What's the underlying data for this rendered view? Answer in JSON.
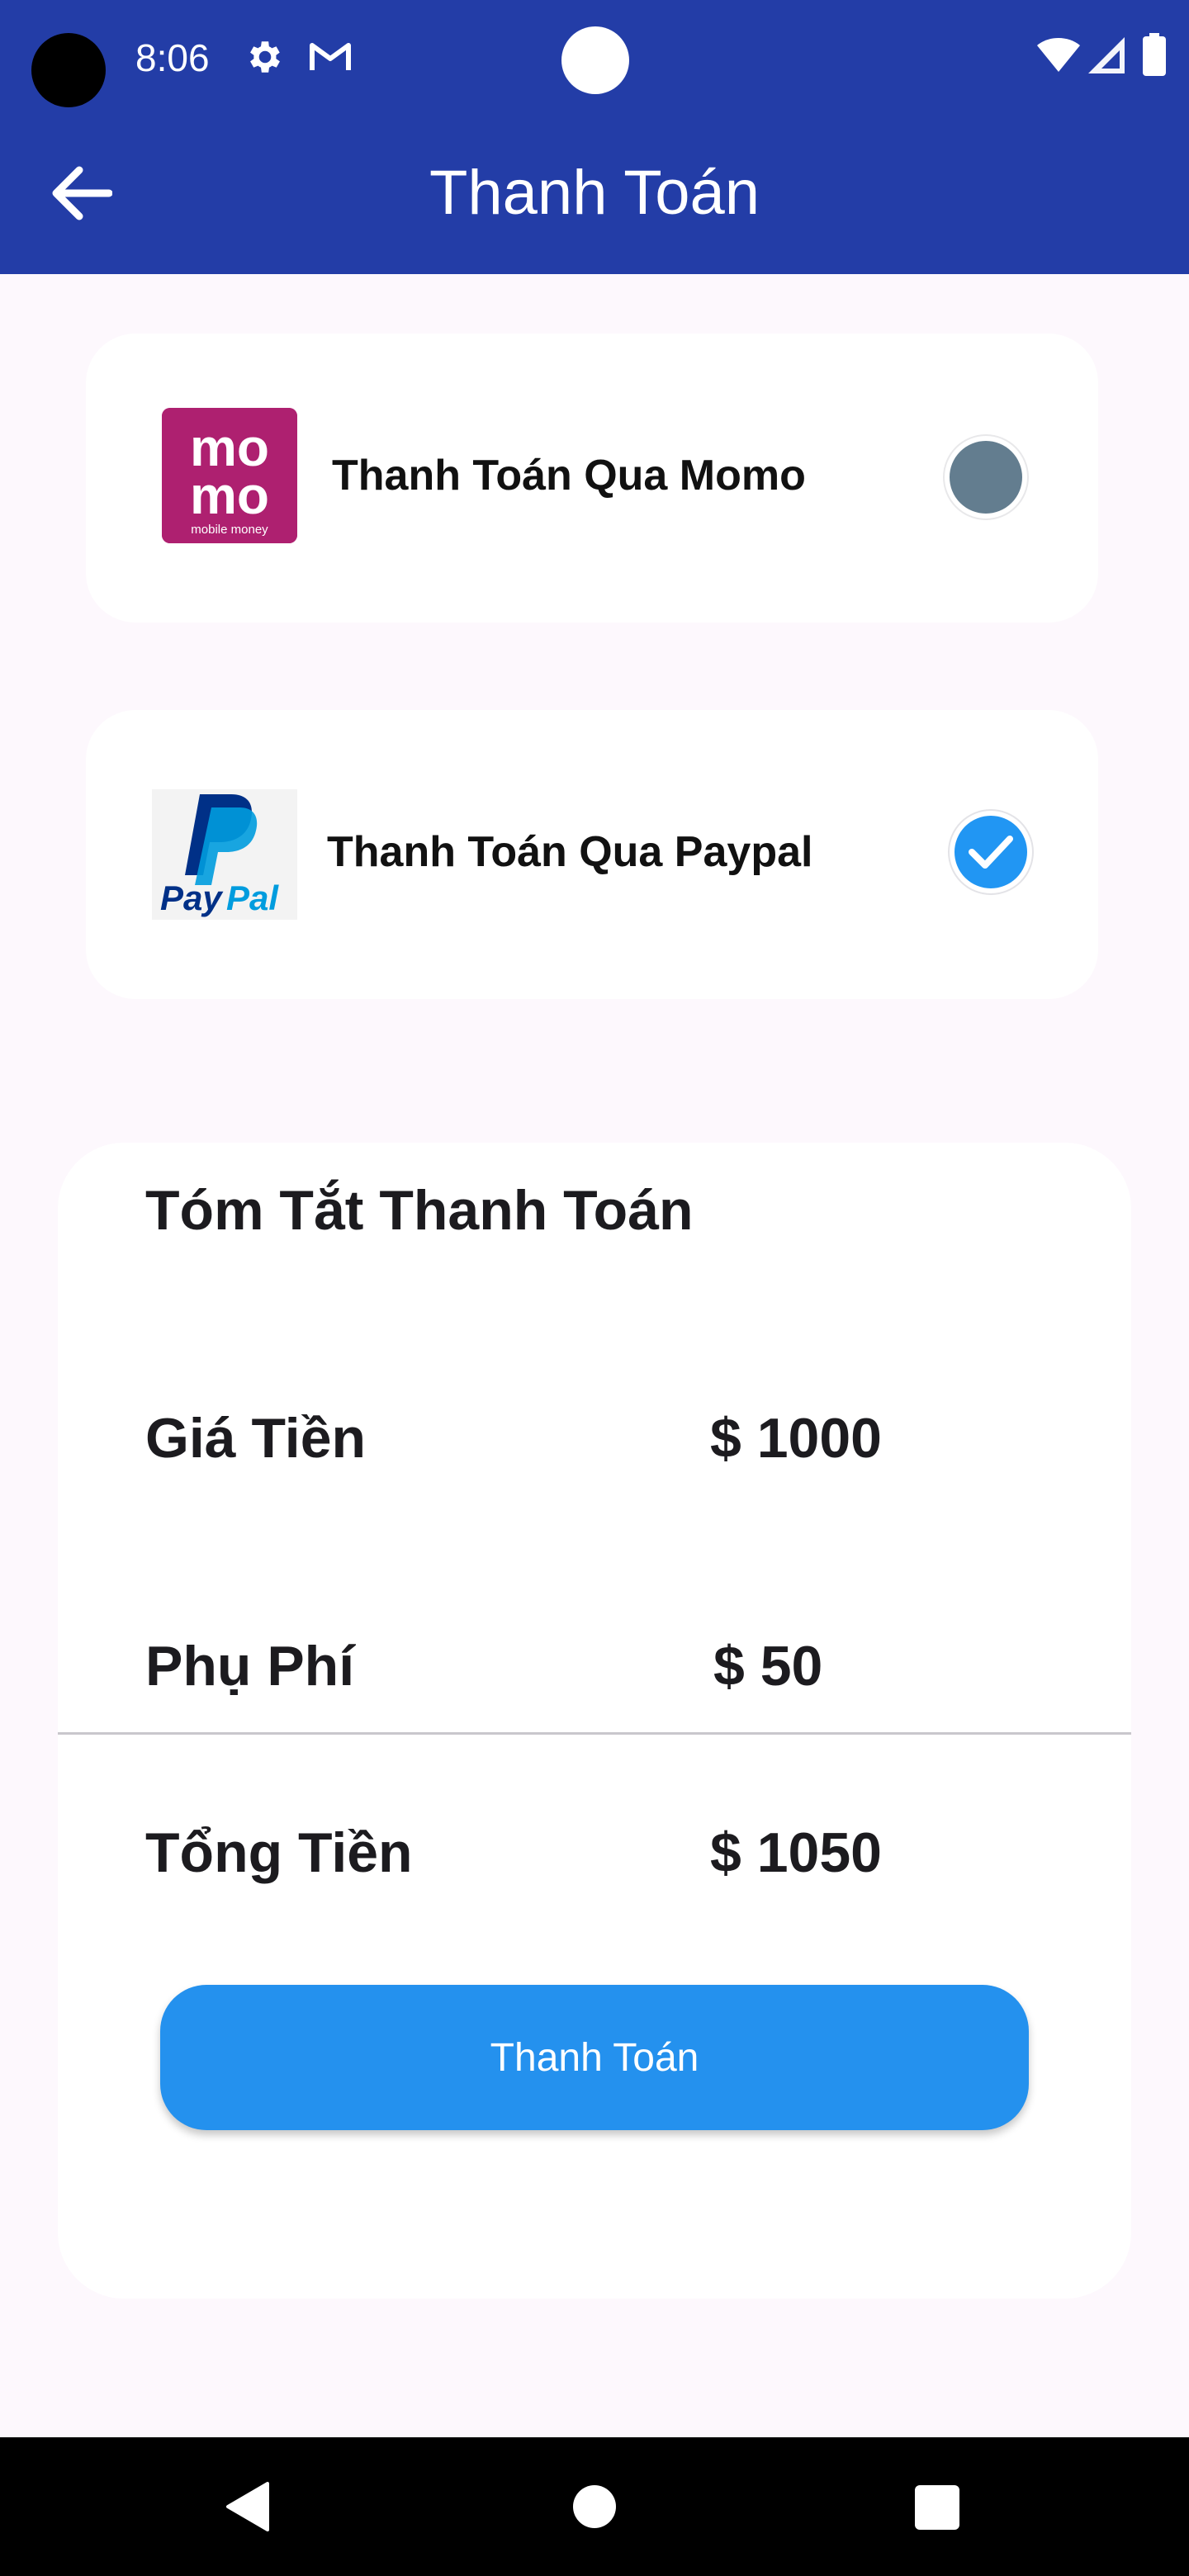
{
  "status_bar": {
    "time": "8:06",
    "icons": [
      "camera-cutout",
      "gear-icon",
      "gmail-icon",
      "wifi-icon",
      "signal-icon",
      "battery-icon"
    ]
  },
  "app_bar": {
    "title": "Thanh Toán",
    "back_icon": "arrow-left-icon",
    "background": "#233da7"
  },
  "payment_methods": [
    {
      "label": "Thanh Toán Qua Momo",
      "logo": {
        "line1": "mo",
        "line2": "mo",
        "caption": "mobile money",
        "color": "#ae2070"
      },
      "selected": false
    },
    {
      "label": "Thanh Toán Qua Paypal",
      "logo": {
        "text_pay": "Pay",
        "text_pal": "Pal"
      },
      "selected": true
    }
  ],
  "summary": {
    "title": "Tóm Tắt Thanh Toán",
    "price_label": "Giá Tiền",
    "price_value": "$ 1000",
    "fee_label": "Phụ Phí",
    "fee_value": "$ 50",
    "total_label": "Tổng Tiền",
    "total_value": "$ 1050",
    "pay_button": "Thanh Toán"
  },
  "colors": {
    "accent": "#2491ee",
    "radio_unselected": "#637d8f",
    "background": "#fdf8fd"
  },
  "nav_bar": {
    "icons": [
      "nav-back-icon",
      "nav-home-icon",
      "nav-recents-icon"
    ]
  }
}
